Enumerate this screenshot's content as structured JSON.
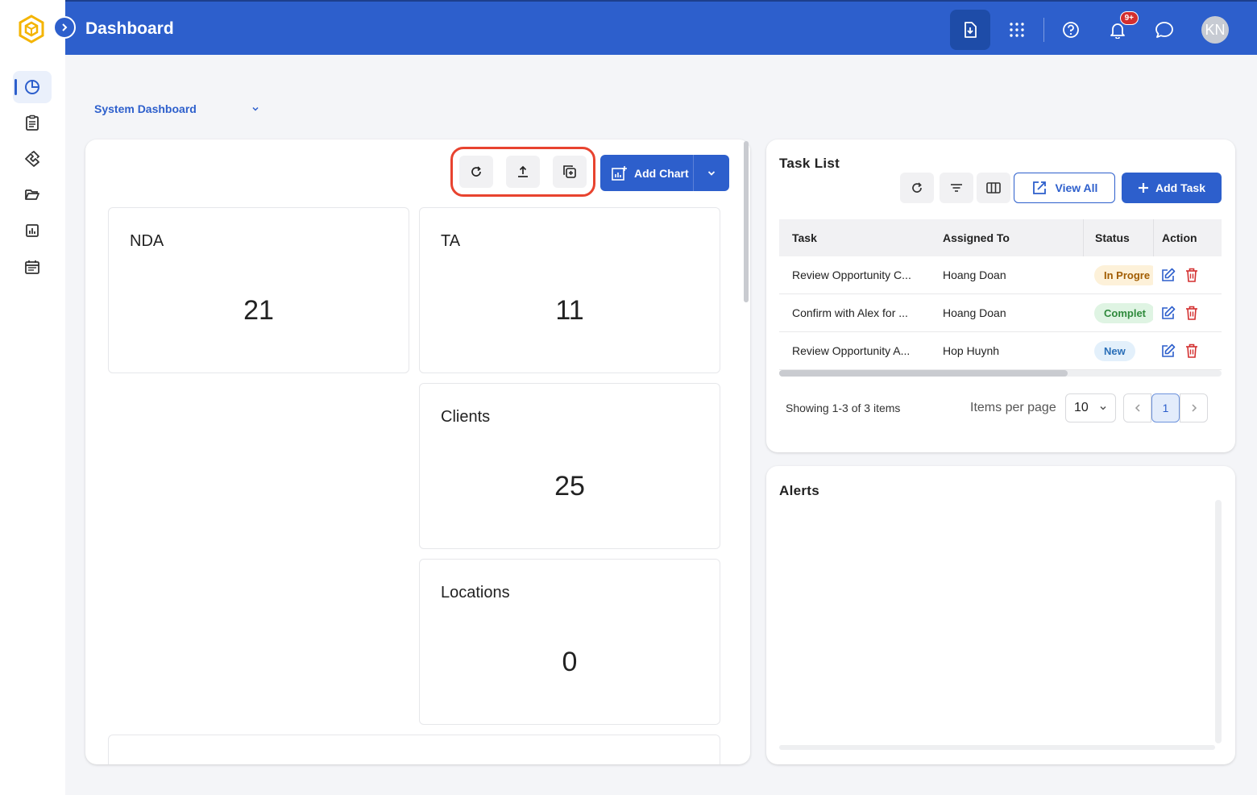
{
  "header": {
    "title": "Dashboard",
    "notification_count": "9+",
    "avatar_initials": "KN"
  },
  "colors": {
    "primary": "#2d5fcc",
    "highlight_ring": "#e8432f",
    "status_in_progress_bg": "#fdf1d9",
    "status_complete_bg": "#dff4e3",
    "status_new_bg": "#e3f0fb"
  },
  "sidebar": {
    "items": [
      {
        "icon": "pie-chart-icon",
        "active": true
      },
      {
        "icon": "clipboard-icon",
        "active": false
      },
      {
        "icon": "handshake-icon",
        "active": false
      },
      {
        "icon": "folder-open-icon",
        "active": false
      },
      {
        "icon": "bar-chart-icon",
        "active": false
      },
      {
        "icon": "calendar-icon",
        "active": false
      }
    ]
  },
  "dashboard_select": {
    "value": "System Dashboard"
  },
  "toolbar": {
    "add_chart_label": "Add Chart"
  },
  "kpis": {
    "nda": {
      "label": "NDA",
      "value": "21"
    },
    "ta": {
      "label": "TA",
      "value": "11"
    },
    "clients": {
      "label": "Clients",
      "value": "25"
    },
    "locations": {
      "label": "Locations",
      "value": "0"
    }
  },
  "task_list": {
    "title": "Task List",
    "view_all_label": "View All",
    "add_task_label": "Add Task",
    "columns": [
      "Task",
      "Assigned To",
      "Status",
      "Action"
    ],
    "rows": [
      {
        "task": "Review Opportunity C...",
        "assigned": "Hoang Doan",
        "status": "In Progre",
        "status_type": "progress"
      },
      {
        "task": "Confirm with Alex for ...",
        "assigned": "Hoang Doan",
        "status": "Complet",
        "status_type": "complete"
      },
      {
        "task": "Review Opportunity A...",
        "assigned": "Hop Huynh",
        "status": "New",
        "status_type": "new"
      }
    ],
    "showing": "Showing 1-3 of 3 items",
    "items_per_page_label": "Items per page",
    "items_per_page_value": "10",
    "current_page": "1"
  },
  "alerts": {
    "title": "Alerts"
  }
}
